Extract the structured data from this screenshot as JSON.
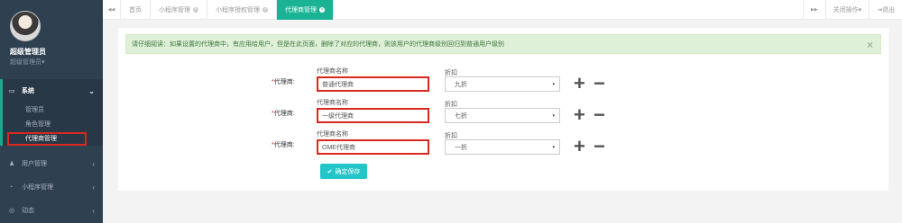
{
  "sidebar": {
    "user_name": "超级管理员",
    "user_role": "超级管理员",
    "role_caret": "▾",
    "menu": [
      {
        "icon": "▭",
        "label": "系统",
        "chevron": "⌄"
      },
      {
        "icon": "♟",
        "label": "用户管理",
        "chevron": "‹"
      },
      {
        "icon": "◔",
        "label": "小程序管理",
        "chevron": "‹"
      },
      {
        "icon": "◎",
        "label": "动态",
        "chevron": "‹"
      }
    ],
    "sub_items": [
      "管理员",
      "角色管理",
      "代理商管理"
    ]
  },
  "tabs": {
    "prev_icon": "◀◀",
    "next_icon": "▶▶",
    "items": [
      {
        "label": "首页",
        "close": ""
      },
      {
        "label": "小程序管理",
        "close": "×"
      },
      {
        "label": "小程序授权管理",
        "close": "×"
      },
      {
        "label": "代理商管理",
        "close": "×"
      }
    ],
    "close_ops": "关闭操作",
    "close_ops_caret": "▾",
    "logout_icon": "⇥",
    "logout": "退出"
  },
  "alert": {
    "text": "请仔细阅读：如果设置的代理商中，有应用给用户，但是在此页面，删除了对应的代理商，则该用户的代理商级别回归到普通用户级别",
    "close": "×"
  },
  "form": {
    "row_label_required": "*",
    "row_label": "代理商:",
    "name_label": "代理商名称",
    "discount_label": "折扣",
    "rows": [
      {
        "name": "普通代理商",
        "discount": "九折"
      },
      {
        "name": "一级代理商",
        "discount": "七折"
      },
      {
        "name": "OME代理商",
        "discount": "一折"
      }
    ],
    "add_icon": "+",
    "remove_icon": "−",
    "caret": "▾",
    "save_icon": "✔",
    "save_label": "确定保存"
  },
  "colors": {
    "sidebar_bg": "#2f4050",
    "accent": "#1ab394",
    "save_button": "#23c6c8",
    "highlight_box": "#d9281e",
    "alert_bg": "#dff0d8"
  }
}
